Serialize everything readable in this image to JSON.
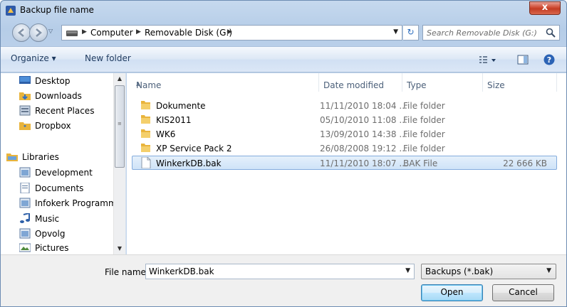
{
  "window": {
    "title": "Backup file name",
    "close_label": "x"
  },
  "nav": {
    "breadcrumbs": [
      "Computer",
      "Removable Disk (G:)"
    ],
    "search_placeholder": "Search Removable Disk (G:)"
  },
  "toolbar": {
    "organize_label": "Organize ▾",
    "newfolder_label": "New folder"
  },
  "sidebar": {
    "items": [
      {
        "label": "Desktop",
        "icon": "desktop-icon"
      },
      {
        "label": "Downloads",
        "icon": "downloads-folder-icon"
      },
      {
        "label": "Recent Places",
        "icon": "recent-places-icon"
      },
      {
        "label": "Dropbox",
        "icon": "dropbox-folder-icon"
      },
      {
        "label": "Libraries",
        "icon": "libraries-icon"
      },
      {
        "label": "Development",
        "icon": "library-doc-icon"
      },
      {
        "label": "Documents",
        "icon": "documents-icon"
      },
      {
        "label": "Infokerk Programme",
        "icon": "library-doc-icon"
      },
      {
        "label": "Music",
        "icon": "music-icon"
      },
      {
        "label": "Opvolg",
        "icon": "library-doc-icon"
      },
      {
        "label": "Pictures",
        "icon": "pictures-icon"
      }
    ]
  },
  "columns": {
    "name": "Name",
    "date": "Date modified",
    "type": "Type",
    "size": "Size"
  },
  "files": [
    {
      "name": "Dokumente",
      "date": "11/11/2010 18:04 ...",
      "type": "File folder",
      "size": ""
    },
    {
      "name": "KIS2011",
      "date": "05/10/2010 11:08 ...",
      "type": "File folder",
      "size": ""
    },
    {
      "name": "WK6",
      "date": "13/09/2010 14:38 ...",
      "type": "File folder",
      "size": ""
    },
    {
      "name": "XP Service Pack 2",
      "date": "26/08/2008 19:12 ...",
      "type": "File folder",
      "size": ""
    },
    {
      "name": "WinkerkDB.bak",
      "date": "11/11/2010 18:07 ...",
      "type": "BAK File",
      "size": "22 666 KB"
    }
  ],
  "footer": {
    "filename_label": "File name:",
    "filename_value": "WinkerkDB.bak",
    "filter_value": "Backups (*.bak)",
    "open_label": "Open",
    "cancel_label": "Cancel"
  },
  "colors": {
    "accent": "#3c7fb1",
    "selection": "#cfe3f8",
    "folder": "#e9b43c"
  }
}
